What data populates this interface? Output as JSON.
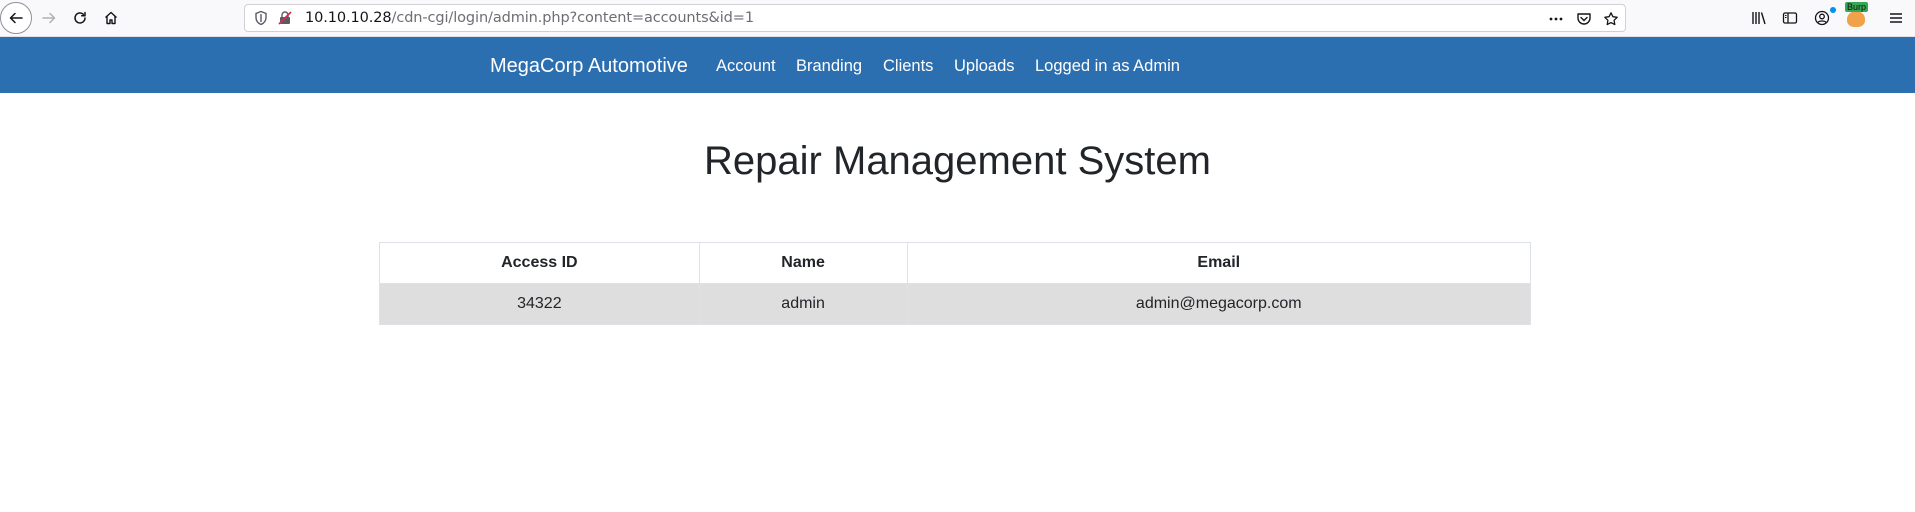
{
  "browser": {
    "url_host": "10.10.10.28",
    "url_path": "/cdn-cgi/login/admin.php?content=accounts&id=1",
    "burp_label": "Burp"
  },
  "navbar": {
    "brand": "MegaCorp Automotive",
    "items": [
      {
        "label": "Account"
      },
      {
        "label": "Branding"
      },
      {
        "label": "Clients"
      },
      {
        "label": "Uploads"
      },
      {
        "label": "Logged in as Admin"
      }
    ],
    "background": "#2c6fb1"
  },
  "main": {
    "title": "Repair Management System",
    "table": {
      "headers": [
        "Access ID",
        "Name",
        "Email"
      ],
      "rows": [
        [
          "34322",
          "admin",
          "admin@megacorp.com"
        ]
      ]
    }
  }
}
